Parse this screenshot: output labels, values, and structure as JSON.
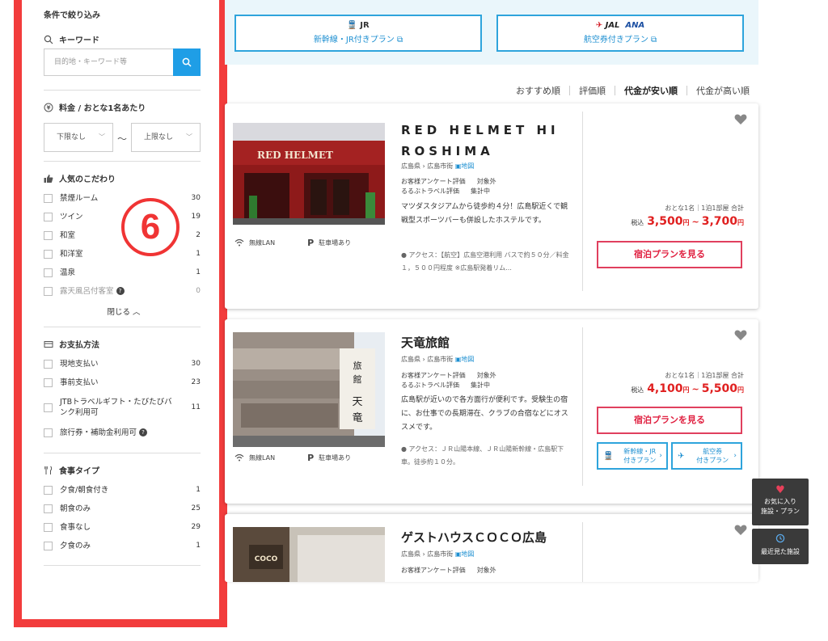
{
  "sidebar": {
    "heading": "条件で絞り込み",
    "keyword": {
      "title": "キーワード",
      "placeholder": "目的地・キーワード等"
    },
    "price": {
      "title": "料金 / おとな1名あたり",
      "min": "下限なし",
      "max": "上限なし",
      "tilde": "〜"
    },
    "popular": {
      "title": "人気のこだわり",
      "items": [
        {
          "label": "禁煙ルーム",
          "count": "30"
        },
        {
          "label": "ツイン",
          "count": "19"
        },
        {
          "label": "和室",
          "count": "2"
        },
        {
          "label": "和洋室",
          "count": "1"
        },
        {
          "label": "温泉",
          "count": "1"
        },
        {
          "label": "露天風呂付客室",
          "count": "0"
        }
      ],
      "close": "閉じる"
    },
    "payment": {
      "title": "お支払方法",
      "items": [
        {
          "label": "現地支払い",
          "count": "30"
        },
        {
          "label": "事前支払い",
          "count": "23"
        },
        {
          "label": "JTBトラベルギフト・たびたびバンク利用可",
          "count": "11"
        },
        {
          "label": "旅行券・補助金利用可",
          "count": ""
        }
      ]
    },
    "meal": {
      "title": "食事タイプ",
      "items": [
        {
          "label": "夕食/朝食付き",
          "count": "1"
        },
        {
          "label": "朝食のみ",
          "count": "25"
        },
        {
          "label": "食事なし",
          "count": "29"
        },
        {
          "label": "夕食のみ",
          "count": "1"
        }
      ]
    }
  },
  "annotation": {
    "number": "6"
  },
  "banner": {
    "jr": {
      "logo": "JR",
      "text": "新幹線・JR付きプラン ⧉"
    },
    "air": {
      "jal": "JAL",
      "ana": "ANA",
      "text": "航空券付きプラン ⧉"
    }
  },
  "sort": {
    "options": [
      "おすすめ順",
      "評価順",
      "代金が安い順",
      "代金が高い順"
    ]
  },
  "hotels": [
    {
      "name_line1": "RED HELMET HI",
      "name_line2": "ROSHIMA",
      "location": "広島県 › 広島市街",
      "map": "地図",
      "eval_label1": "お客様アンケート評価",
      "eval_value1": "対象外",
      "eval_label2": "るるぶトラベル評価",
      "eval_value2": "集計中",
      "description": "マツダスタジアムから徒歩約４分！広島駅近くで観戦型スポーツバーも併設したホステルです。",
      "access": "アクセス：【航空】広島空港利用 バスで約５０分／料金１，５００円程度 ※広島駅発着リム...",
      "amenity1": "無線LAN",
      "amenity2": "駐車場あり",
      "price_label": "おとな1名｜1泊1部屋 合計",
      "tax": "税込",
      "price_min": "3,500",
      "price_max": "3,700",
      "yen": "円",
      "plan_button": "宿泊プランを見る"
    },
    {
      "name": "天竜旅館",
      "location": "広島県 › 広島市街",
      "map": "地図",
      "eval_label1": "お客様アンケート評価",
      "eval_value1": "対象外",
      "eval_label2": "るるぶトラベル評価",
      "eval_value2": "集計中",
      "description": "広島駅が近いので各方面行が便利です。受験生の宿に、お仕事での長期滞在、クラブの合宿などにオススメです。",
      "access": "アクセス：ＪＲ山陽本線、ＪＲ山陽新幹線・広島駅下車。徒歩約１０分。",
      "amenity1": "無線LAN",
      "amenity2": "駐車場あり",
      "price_label": "おとな1名｜1泊1部屋 合計",
      "tax": "税込",
      "price_min": "4,100",
      "price_max": "5,500",
      "yen": "円",
      "plan_button": "宿泊プランを見る",
      "jr_plan_line1": "新幹線・JR",
      "jr_plan_line2": "付きプラン",
      "air_plan_line1": "航空券",
      "air_plan_line2": "付きプラン"
    },
    {
      "name": "ゲストハウスＣＯＣＯ広島",
      "location": "広島県 › 広島市街",
      "map": "地図",
      "eval_label1": "お客様アンケート評価",
      "eval_value1": "対象外",
      "sign_text": "COCO"
    }
  ],
  "floating": {
    "favorites_line1": "お気に入り",
    "favorites_line2": "施設・プラン",
    "recent": "最近見た施設"
  },
  "colors": {
    "accent_blue": "#1f9ee6",
    "price_red": "#e02020",
    "annotation_red": "#f23c3c"
  }
}
